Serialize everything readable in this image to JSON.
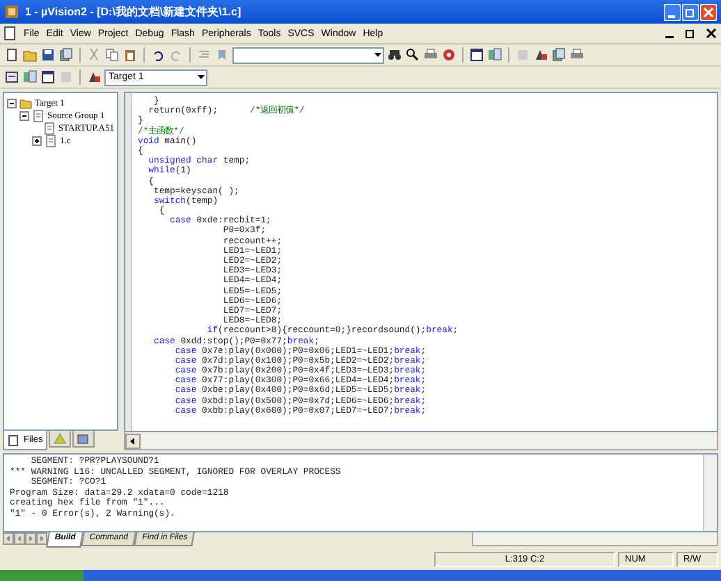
{
  "window": {
    "title": "1  - µVision2 - [D:\\我的文档\\新建文件夹\\1.c]"
  },
  "menu": [
    "File",
    "Edit",
    "View",
    "Project",
    "Debug",
    "Flash",
    "Peripherals",
    "Tools",
    "SVCS",
    "Window",
    "Help"
  ],
  "target_select": {
    "value": "Target 1"
  },
  "project_tree": [
    {
      "label": "Target 1",
      "expanded": true,
      "children": [
        {
          "label": "Source Group 1",
          "expanded": true,
          "children": [
            {
              "label": "STARTUP.A51"
            },
            {
              "label": "1.c",
              "expanded": false
            }
          ]
        }
      ]
    }
  ],
  "panel_tabs": [
    {
      "label": "Files",
      "kind": "files",
      "selected": true
    },
    {
      "kind": "regs",
      "selected": false
    },
    {
      "kind": "books",
      "selected": false
    }
  ],
  "editor": {
    "lines": [
      [
        {
          "kind": "text",
          "text": "   }"
        }
      ],
      [
        {
          "kind": "text",
          "text": "  return(0xff);      "
        },
        {
          "kind": "comment",
          "text": "/*返回初值*/"
        }
      ],
      [
        {
          "kind": "text",
          "text": "}"
        }
      ],
      [
        {
          "kind": "comment",
          "text": "/*主函数*/"
        }
      ],
      [
        {
          "kind": "keyword",
          "text": "void"
        },
        {
          "kind": "text",
          "text": " main()"
        }
      ],
      [
        {
          "kind": "text",
          "text": "{"
        }
      ],
      [
        {
          "kind": "keyword",
          "text": "  unsigned char"
        },
        {
          "kind": "text",
          "text": " temp;"
        }
      ],
      [
        {
          "kind": "keyword",
          "text": "  while"
        },
        {
          "kind": "text",
          "text": "(1)"
        }
      ],
      [
        {
          "kind": "text",
          "text": "  {"
        }
      ],
      [
        {
          "kind": "text",
          "text": "   temp=keyscan( );"
        }
      ],
      [
        {
          "kind": "keyword",
          "text": "   switch"
        },
        {
          "kind": "text",
          "text": "(temp)"
        }
      ],
      [
        {
          "kind": "text",
          "text": "    {"
        }
      ],
      [
        {
          "kind": "keyword",
          "text": "      case"
        },
        {
          "kind": "text",
          "text": " 0xde:recbit=1;"
        }
      ],
      [
        {
          "kind": "text",
          "text": "                P0=0x3f;"
        }
      ],
      [
        {
          "kind": "text",
          "text": "                reccount++;"
        }
      ],
      [
        {
          "kind": "text",
          "text": "                LED1=~LED1;"
        }
      ],
      [
        {
          "kind": "text",
          "text": "                LED2=~LED2;"
        }
      ],
      [
        {
          "kind": "text",
          "text": "                LED3=~LED3;"
        }
      ],
      [
        {
          "kind": "text",
          "text": "                LED4=~LED4;"
        }
      ],
      [
        {
          "kind": "text",
          "text": "                LED5=~LED5;"
        }
      ],
      [
        {
          "kind": "text",
          "text": "                LED6=~LED6;"
        }
      ],
      [
        {
          "kind": "text",
          "text": "                LED7=~LED7;"
        }
      ],
      [
        {
          "kind": "text",
          "text": "                LED8=~LED8;"
        }
      ],
      [
        {
          "kind": "keyword",
          "text": "             if"
        },
        {
          "kind": "text",
          "text": "(reccount>8){reccount=0;}recordsound();"
        },
        {
          "kind": "keyword",
          "text": "break"
        },
        {
          "kind": "text",
          "text": ";"
        }
      ],
      [
        {
          "kind": "keyword",
          "text": "   case"
        },
        {
          "kind": "text",
          "text": " 0xdd:stop();P0=0x77;"
        },
        {
          "kind": "keyword",
          "text": "break"
        },
        {
          "kind": "text",
          "text": ";"
        }
      ],
      [
        {
          "kind": "keyword",
          "text": "       case"
        },
        {
          "kind": "text",
          "text": " 0x7e:play(0x000);P0=0x06;LED1=~LED1;"
        },
        {
          "kind": "keyword",
          "text": "break"
        },
        {
          "kind": "text",
          "text": ";"
        }
      ],
      [
        {
          "kind": "keyword",
          "text": "       case"
        },
        {
          "kind": "text",
          "text": " 0x7d:play(0x100);P0=0x5b;LED2=~LED2;"
        },
        {
          "kind": "keyword",
          "text": "break"
        },
        {
          "kind": "text",
          "text": ";"
        }
      ],
      [
        {
          "kind": "keyword",
          "text": "       case"
        },
        {
          "kind": "text",
          "text": " 0x7b:play(0x200);P0=0x4f;LED3=~LED3;"
        },
        {
          "kind": "keyword",
          "text": "break"
        },
        {
          "kind": "text",
          "text": ";"
        }
      ],
      [
        {
          "kind": "keyword",
          "text": "       case"
        },
        {
          "kind": "text",
          "text": " 0x77:play(0x300);P0=0x66;LED4=~LED4;"
        },
        {
          "kind": "keyword",
          "text": "break"
        },
        {
          "kind": "text",
          "text": ";"
        }
      ],
      [
        {
          "kind": "keyword",
          "text": "       case"
        },
        {
          "kind": "text",
          "text": " 0xbe:play(0x400);P0=0x6d;LED5=~LED5;"
        },
        {
          "kind": "keyword",
          "text": "break"
        },
        {
          "kind": "text",
          "text": ";"
        }
      ],
      [
        {
          "kind": "keyword",
          "text": "       case"
        },
        {
          "kind": "text",
          "text": " 0xbd:play(0x500);P0=0x7d;LED6=~LED6;"
        },
        {
          "kind": "keyword",
          "text": "break"
        },
        {
          "kind": "text",
          "text": ";"
        }
      ],
      [
        {
          "kind": "keyword",
          "text": "       case"
        },
        {
          "kind": "text",
          "text": " 0xbb:play(0x600);P0=0x07;LED7=~LED7;"
        },
        {
          "kind": "keyword",
          "text": "break"
        },
        {
          "kind": "text",
          "text": ";"
        }
      ]
    ]
  },
  "output": {
    "lines": [
      "    SEGMENT: ?PR?PLAYSOUND?1",
      "*** WARNING L16: UNCALLED SEGMENT, IGNORED FOR OVERLAY PROCESS",
      "    SEGMENT: ?CO?1",
      "Program Size: data=29.2 xdata=0 code=1218",
      "creating hex file from \"1\"...",
      "\"1\" - 0 Error(s), 2 Warning(s)."
    ],
    "tabs": [
      {
        "label": "Build",
        "selected": true
      },
      {
        "label": "Command",
        "selected": false
      },
      {
        "label": "Find in Files",
        "selected": false
      }
    ]
  },
  "status_bar": {
    "position": "L:319 C:2",
    "num": "NUM",
    "mode": "R/W"
  }
}
